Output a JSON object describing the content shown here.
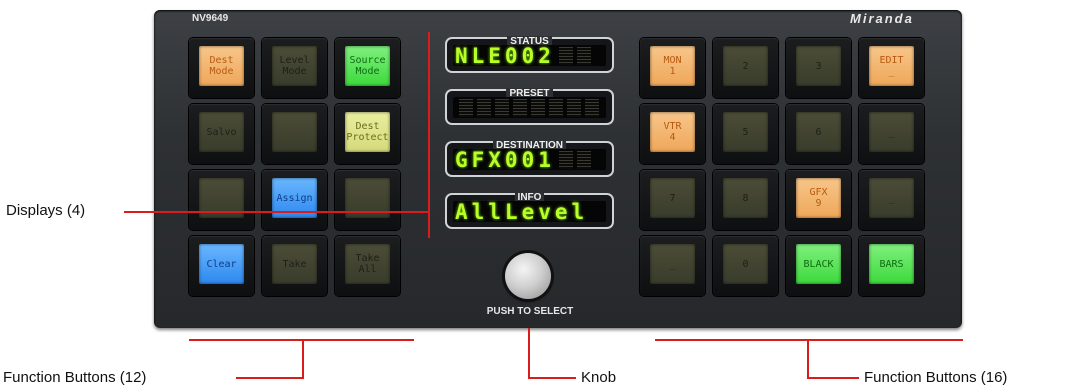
{
  "device": {
    "model": "NV9649",
    "brand": "Miranda",
    "knob_label": "PUSH TO SELECT"
  },
  "left_buttons": [
    {
      "label": "Dest\nMode",
      "color": "orange"
    },
    {
      "label": "Level\nMode",
      "color": "dark"
    },
    {
      "label": "Source\nMode",
      "color": "green"
    },
    {
      "label": "Salvo",
      "color": "dark"
    },
    {
      "label": "",
      "color": "dark"
    },
    {
      "label": "Dest\nProtect",
      "color": "yellow"
    },
    {
      "label": "",
      "color": "dark"
    },
    {
      "label": "Assign",
      "color": "blue"
    },
    {
      "label": "",
      "color": "dark"
    },
    {
      "label": "Clear",
      "color": "blue"
    },
    {
      "label": "Take",
      "color": "dark"
    },
    {
      "label": "Take\nAll",
      "color": "dark"
    }
  ],
  "right_buttons": [
    {
      "label": "MON\n1",
      "color": "orange"
    },
    {
      "label": "2",
      "color": "dark"
    },
    {
      "label": "3",
      "color": "dark"
    },
    {
      "label": "EDIT\n_",
      "color": "orange"
    },
    {
      "label": "VTR\n4",
      "color": "orange"
    },
    {
      "label": "5",
      "color": "dark"
    },
    {
      "label": "6",
      "color": "dark"
    },
    {
      "label": "_",
      "color": "dark"
    },
    {
      "label": "7",
      "color": "dark"
    },
    {
      "label": "8",
      "color": "dark"
    },
    {
      "label": "GFX\n9",
      "color": "orange"
    },
    {
      "label": "_",
      "color": "dark"
    },
    {
      "label": "_",
      "color": "dark"
    },
    {
      "label": "0",
      "color": "dark"
    },
    {
      "label": "BLACK",
      "color": "green"
    },
    {
      "label": "BARS",
      "color": "green"
    }
  ],
  "displays": [
    {
      "label": "STATUS",
      "text": "NLE002"
    },
    {
      "label": "PRESET",
      "text": ""
    },
    {
      "label": "DESTINATION",
      "text": "GFX001"
    },
    {
      "label": "INFO",
      "text": "AllLevel"
    }
  ],
  "callouts": {
    "displays": "Displays (4)",
    "left_buttons": "Function Buttons (12)",
    "knob": "Knob",
    "right_buttons": "Function Buttons (16)"
  },
  "colors": {
    "annotation_line": "#d91c1c",
    "orange": "#f0ae63",
    "green": "#4ee04c",
    "yellow": "#dde28a",
    "blue": "#3c94f4",
    "display_text": "#b8ff2a"
  }
}
